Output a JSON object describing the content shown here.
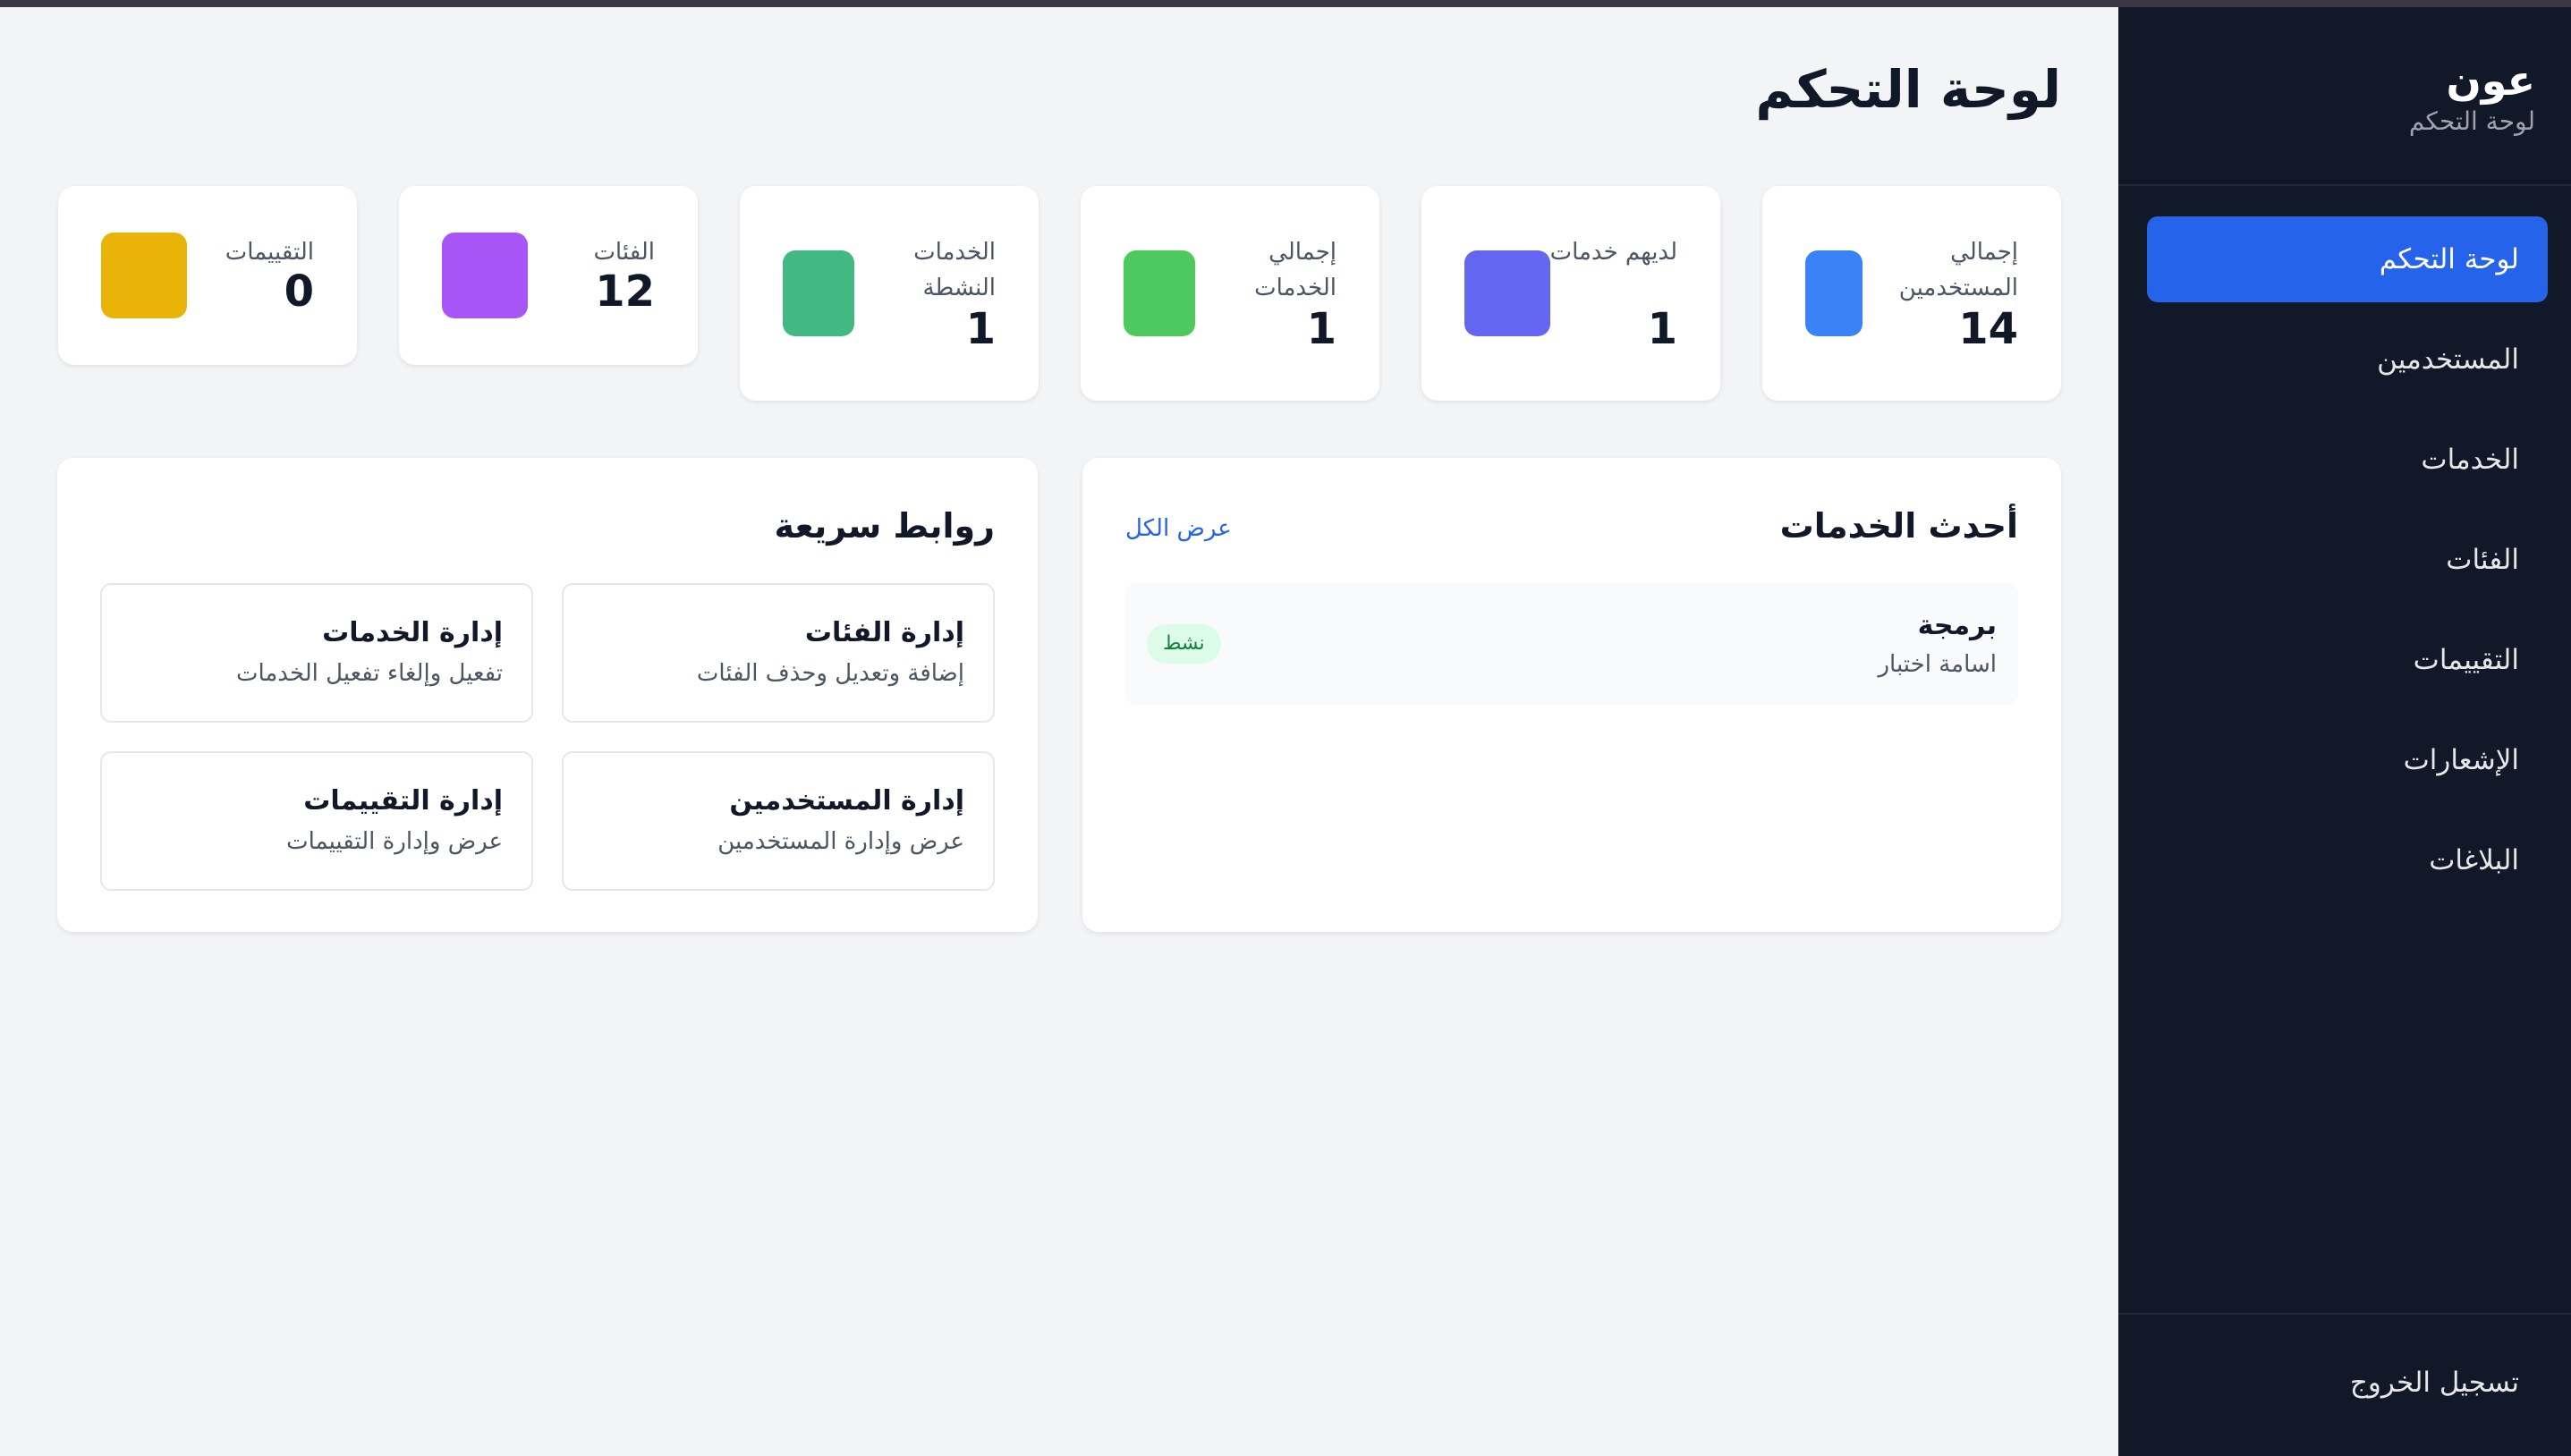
{
  "brand": {
    "name": "عون",
    "subtitle": "لوحة التحكم"
  },
  "sidebar": {
    "items": [
      {
        "label": "لوحة التحكم",
        "active": true
      },
      {
        "label": "المستخدمين",
        "active": false
      },
      {
        "label": "الخدمات",
        "active": false
      },
      {
        "label": "الفئات",
        "active": false
      },
      {
        "label": "التقييمات",
        "active": false
      },
      {
        "label": "الإشعارات",
        "active": false
      },
      {
        "label": "البلاغات",
        "active": false
      }
    ],
    "logout_label": "تسجيل الخروج"
  },
  "page": {
    "title": "لوحة التحكم"
  },
  "stats": [
    {
      "label": "إجمالي المستخدمين",
      "value": "14",
      "color": "#3b82f6"
    },
    {
      "label": "لديهم خدمات",
      "value": "1",
      "color": "#6366f1"
    },
    {
      "label": "إجمالي الخدمات",
      "value": "1",
      "color": "#4ec95d"
    },
    {
      "label": "الخدمات النشطة",
      "value": "1",
      "color": "#42b883"
    },
    {
      "label": "الفئات",
      "value": "12",
      "color": "#a855f7"
    },
    {
      "label": "التقييمات",
      "value": "0",
      "color": "#eab308"
    }
  ],
  "latest_services": {
    "title": "أحدث الخدمات",
    "view_all": "عرض الكل",
    "items": [
      {
        "name": "برمجة",
        "owner": "اسامة اختبار",
        "status": "نشط"
      }
    ]
  },
  "quick_links": {
    "title": "روابط سريعة",
    "items": [
      {
        "title": "إدارة الفئات",
        "desc": "إضافة وتعديل وحذف الفئات"
      },
      {
        "title": "إدارة الخدمات",
        "desc": "تفعيل وإلغاء تفعيل الخدمات"
      },
      {
        "title": "إدارة المستخدمين",
        "desc": "عرض وإدارة المستخدمين"
      },
      {
        "title": "إدارة التقييمات",
        "desc": "عرض وإدارة التقييمات"
      }
    ]
  }
}
